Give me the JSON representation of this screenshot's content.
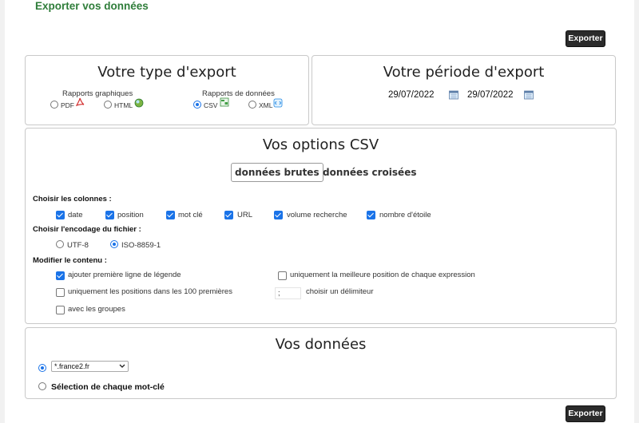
{
  "page": {
    "title": "Exporter vos données",
    "export_label": "Exporter"
  },
  "type_box": {
    "title": "Votre type d'export",
    "graph_group": "Rapports graphiques",
    "data_group": "Rapports de données",
    "options": [
      {
        "label": "PDF",
        "selected": false,
        "icon": "pdf-icon"
      },
      {
        "label": "HTML",
        "selected": false,
        "icon": "globe-icon"
      },
      {
        "label": "CSV",
        "selected": true,
        "icon": "spreadsheet-icon"
      },
      {
        "label": "XML",
        "selected": false,
        "icon": "xml-icon"
      }
    ]
  },
  "period_box": {
    "title": "Votre période d'export",
    "start_date": "29/07/2022",
    "end_date": "29/07/2022"
  },
  "csv_box": {
    "title": "Vos options CSV",
    "tabs": [
      "données brutes",
      "données croisées"
    ],
    "columns_label": "Choisir les colonnes :",
    "columns": [
      {
        "label": "date",
        "checked": true
      },
      {
        "label": "position",
        "checked": true
      },
      {
        "label": "mot clé",
        "checked": true
      },
      {
        "label": "URL",
        "checked": true
      },
      {
        "label": "volume recherche",
        "checked": true
      },
      {
        "label": "nombre d'étoile",
        "checked": true
      }
    ],
    "encoding_label": "Choisir l'encodage du fichier :",
    "encodings": [
      {
        "label": "UTF-8",
        "selected": false
      },
      {
        "label": "ISO-8859-1",
        "selected": true
      }
    ],
    "modify_label": "Modifier le contenu :",
    "modify_options": {
      "legend": "ajouter première ligne de légende",
      "best_position": "uniquement la meilleure position de chaque expression",
      "top100": "uniquement les positions dans les 100 premières",
      "groups": "avec les groupes"
    },
    "delimiter_value": ";",
    "delimiter_label": "choisir un délimiteur"
  },
  "data_box": {
    "title": "Vos données",
    "site_select": "*.france2.fr",
    "each_keyword": "Sélection de chaque mot-clé"
  },
  "colors": {
    "accent": "#1a73e8",
    "title_green": "#2f7d3a",
    "button_dark": "#2b2b2b"
  }
}
